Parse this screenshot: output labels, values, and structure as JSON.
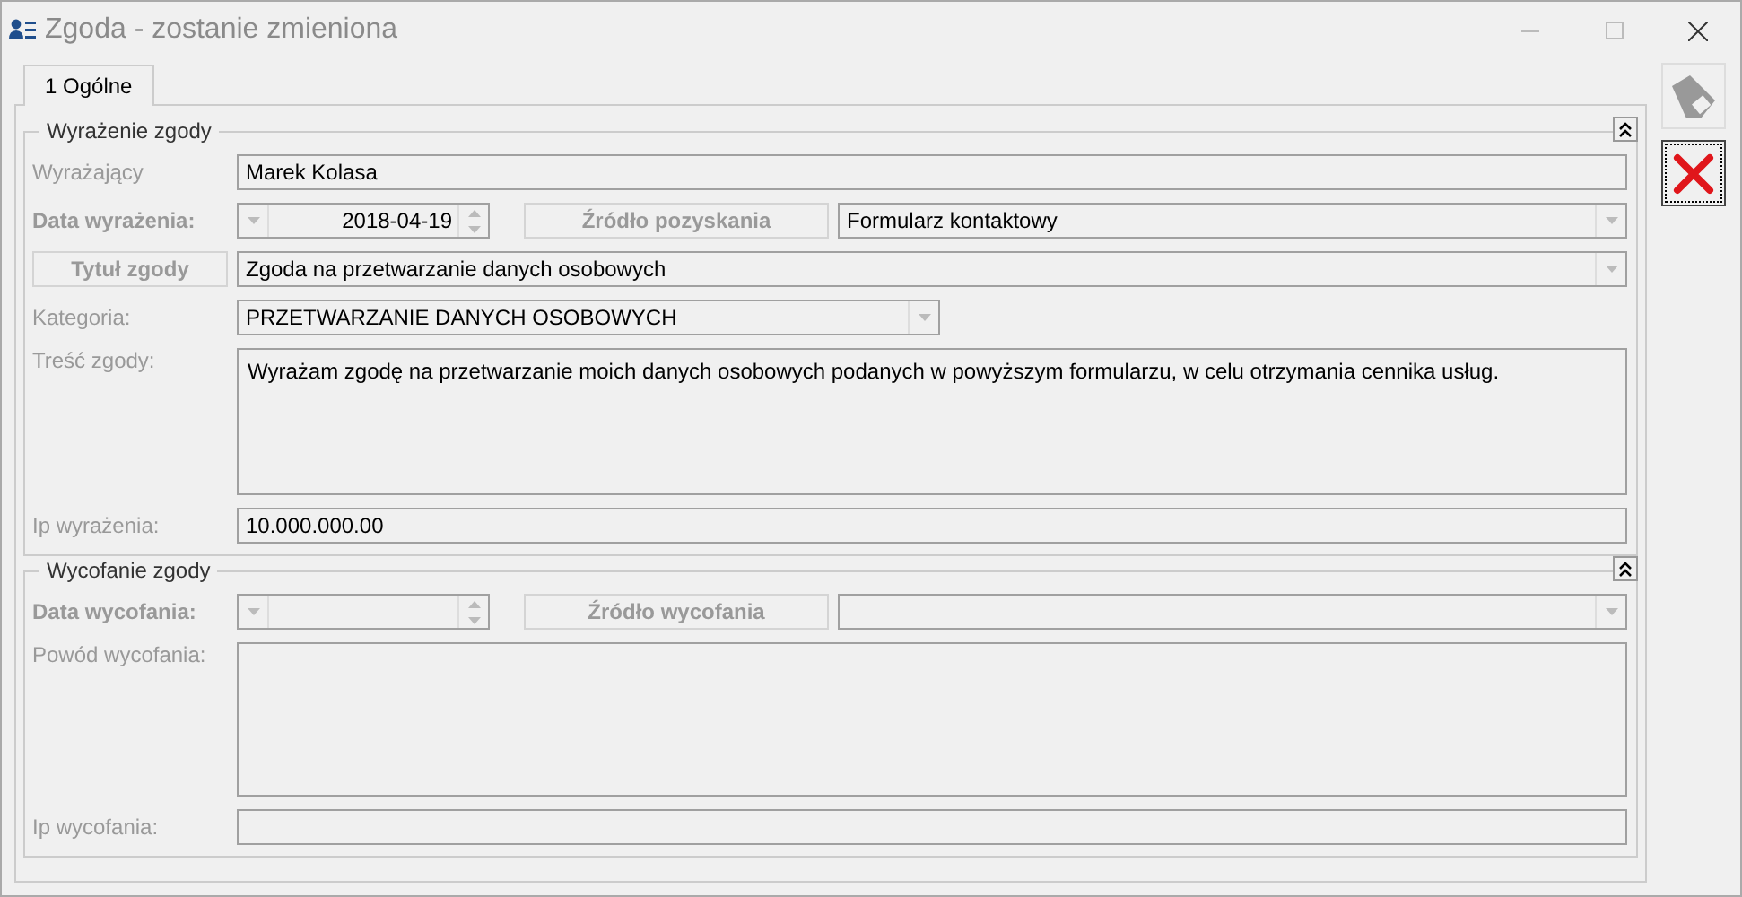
{
  "window": {
    "title": "Zgoda - zostanie zmieniona"
  },
  "tabs": [
    {
      "label": "1 Ogólne",
      "selected": true
    }
  ],
  "sections": [
    {
      "title": "Wyrażenie zgody",
      "expanded": true,
      "rows": [
        {
          "kind": "text",
          "label": "Wyrażający",
          "value": "Marek Kolasa"
        },
        {
          "kind": "date-source",
          "label": "Data wyrażenia:",
          "date": "2018-04-19",
          "button": "Źródło pozyskania",
          "value": "Formularz kontaktowy"
        },
        {
          "kind": "button-combo",
          "button": "Tytuł zgody",
          "value": "Zgoda na przetwarzanie danych osobowych"
        },
        {
          "kind": "combo",
          "label": "Kategoria:",
          "value": "PRZETWARZANIE DANYCH OSOBOWYCH"
        },
        {
          "kind": "memo",
          "label": "Treść zgody:",
          "value": "Wyrażam zgodę na przetwarzanie moich danych osobowych podanych w powyższym formularzu, w celu otrzymania cennika usług."
        },
        {
          "kind": "text",
          "label": "Ip wyrażenia:",
          "value": "10.000.000.00"
        }
      ]
    },
    {
      "title": "Wycofanie zgody",
      "expanded": true,
      "rows": [
        {
          "kind": "date-source",
          "label": "Data wycofania:",
          "button": "Źródło wycofania"
        },
        {
          "kind": "memo",
          "label": "Powód wycofania:"
        },
        {
          "kind": "text",
          "label": "Ip wycofania:"
        }
      ]
    }
  ],
  "toolbar": [
    {
      "kind": "save",
      "disabled": true
    },
    {
      "kind": "cancel",
      "disabled": false
    }
  ]
}
